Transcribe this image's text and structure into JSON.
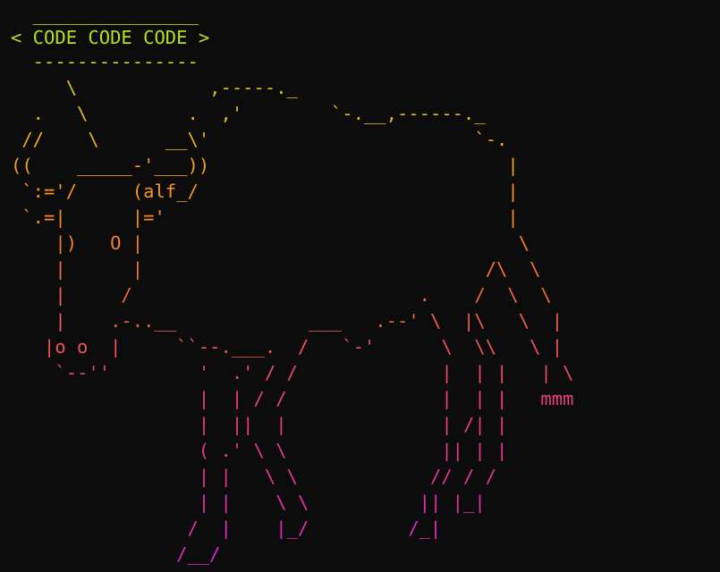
{
  "lines": [
    {
      "text": "  _______________",
      "color": "#b6e11c"
    },
    {
      "text": "< CODE CODE CODE >",
      "color": "#b4e01e"
    },
    {
      "text": "  ---------------",
      "color": "#b2dc20"
    },
    {
      "text": "     \\            ,-----._",
      "color": "#d9c218"
    },
    {
      "text": "  .   \\         .  ,'        `-.__,------._",
      "color": "#e5b81a"
    },
    {
      "text": " //    \\      __\\'                        `-.",
      "color": "#ecac1c"
    },
    {
      "text": "((    _____-'___))                           |",
      "color": "#f2a01e"
    },
    {
      "text": " `:='/     (alf_/                            |",
      "color": "#f6941f"
    },
    {
      "text": " `.=|      |='                               |",
      "color": "#f88822"
    },
    {
      "text": "    |)   O |                                  \\",
      "color": "#f87d2a"
    },
    {
      "text": "    |      |                               /\\  \\",
      "color": "#f57232"
    },
    {
      "text": "    |     /                          .    /  \\  \\",
      "color": "#f2683c"
    },
    {
      "text": "    |    .-..__            ___   .--' \\  |\\   \\  |",
      "color": "#ef5e48"
    },
    {
      "text": "   |o o  |     ``--.___.  /   `-'      \\  \\\\   \\ |",
      "color": "#ec5456"
    },
    {
      "text": "    `--''        '  .' / /             |  | |   | \\",
      "color": "#ea4b64"
    },
    {
      "text": "                 |  | / /              |  | |   mmm",
      "color": "#e84372"
    },
    {
      "text": "                 |  ||  |              | /| |",
      "color": "#e63c80"
    },
    {
      "text": "                 ( .' \\ \\              || | |",
      "color": "#e4378e"
    },
    {
      "text": "                 | |   \\ \\            // / /",
      "color": "#e2339c"
    },
    {
      "text": "                 | |    \\ \\          || |_|",
      "color": "#e030aa"
    },
    {
      "text": "                /  |    |_/         /_|",
      "color": "#de2eb6"
    },
    {
      "text": "               /__/",
      "color": "#dc2cc2"
    }
  ]
}
